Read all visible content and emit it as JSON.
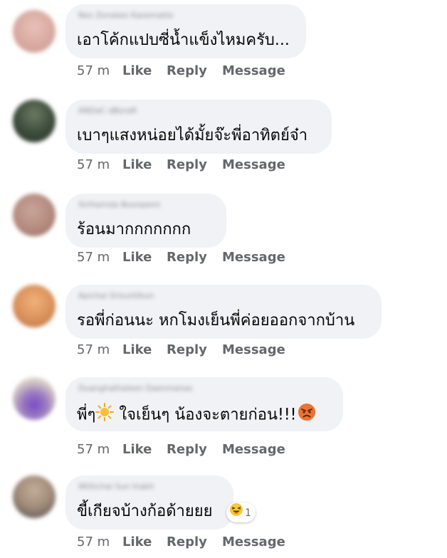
{
  "comments": [
    {
      "author": "Nes Zenekes Kasematte",
      "text": "เอาโค้กแปบซี่น้ำแข็งไหมครับ...",
      "time": "57 m",
      "avatar_color": "#d9a9a0"
    },
    {
      "author": "ANDaC dBoraR",
      "text": "เบาๆแสงหน่อยได้มั้ยจ๊ะพี่อาทิตย์จ๋า",
      "time": "57 m",
      "avatar_color": "#3b4a3a"
    },
    {
      "author": "Siriharnda Boonpenn",
      "text": "ร้อนมากกกกกกก",
      "time": "57 m",
      "avatar_color": "#b48a7e"
    },
    {
      "author": "Apichai Srisuntibun",
      "text": "รอพี่ก่อนนะ หกโมงเย็นพี่ค่อยออกจากบ้าน",
      "time": "57 m",
      "avatar_color": "#d9905a"
    },
    {
      "author": "Duanghathaleen Daenmanas",
      "text_before": "พี่ๆ",
      "text_after": " ใจเย็นๆ น้องจะตายก่อน!!!",
      "time": "57 m",
      "avatar_color": "#9b7bbf"
    },
    {
      "author": "Wittichai Sun Inakh",
      "text": "ขี้เกียจบ้างก้อด้ายยย",
      "time": "57 m",
      "avatar_color": "#a08a78",
      "reaction_count": "1"
    }
  ],
  "actions": {
    "like": "Like",
    "reply": "Reply",
    "message": "Message"
  },
  "colors": {
    "bubble": "#f0f2f5",
    "meta": "#65676b",
    "text": "#050505",
    "sun": "#f5a623",
    "angry": "#e8562a",
    "laugh": "#f7c934"
  },
  "icons": {
    "sun": "sun-emoji-icon",
    "angry": "angry-face-emoji-icon",
    "laugh": "laughing-face-reaction-icon"
  }
}
